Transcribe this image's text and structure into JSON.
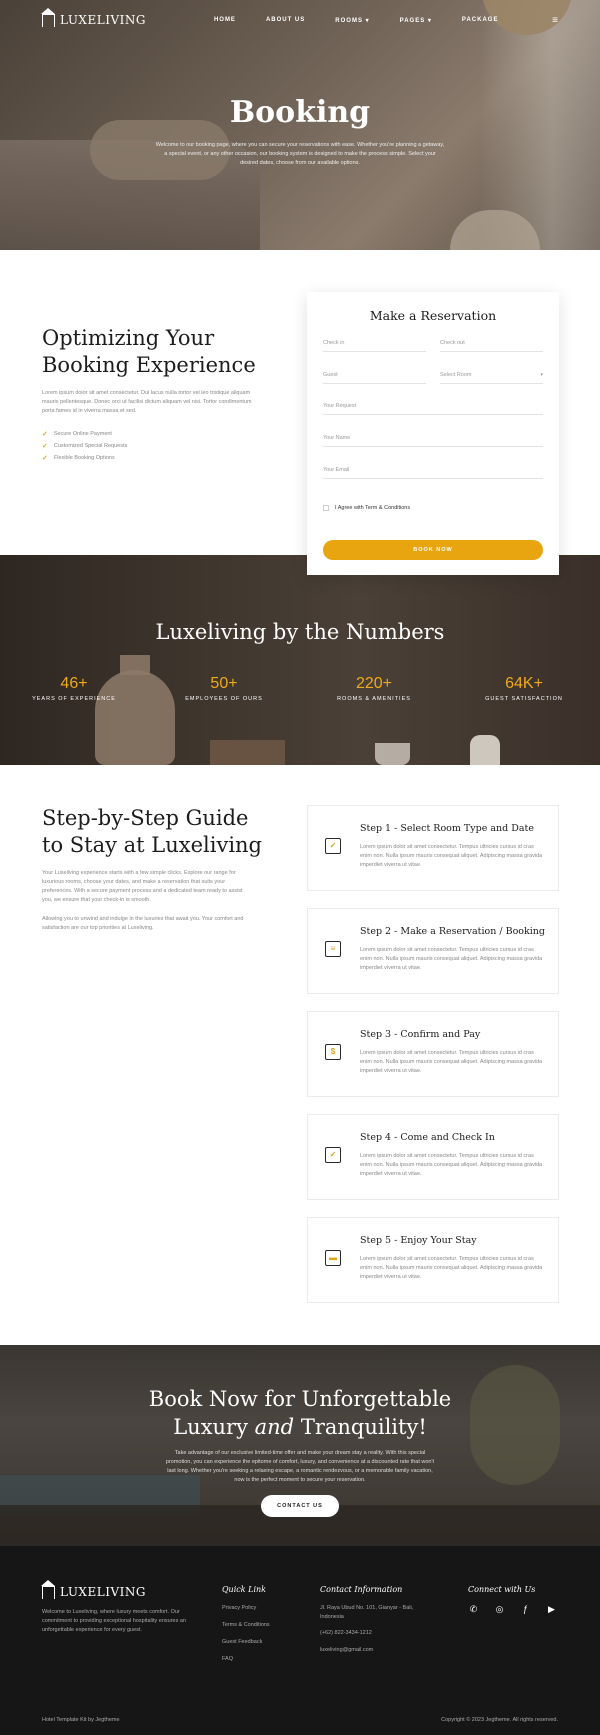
{
  "nav": {
    "logo": "LUXELIVING",
    "items": [
      "HOME",
      "ABOUT US",
      "ROOMS ▾",
      "PAGES ▾",
      "PACKAGE"
    ],
    "menu_icon": "hamburger-icon"
  },
  "hero": {
    "title": "Booking",
    "subtitle": "Welcome to our booking page, where you can secure your reservations with ease. Whether you're planning a getaway, a special event, or any other occasion, our booking system is designed to make the process simple. Select your desired dates, choose from our available options."
  },
  "booking": {
    "heading_line1": "Optimizing Your",
    "heading_line2": "Booking Experience",
    "text": "Lorem ipsum dolor sit amet consectetur. Dui lacus nulla tortor vel leo tristique aliquam mauris pellentesque. Donec orci ut facilisi dictum aliquam vel nisi. Tortor condimentum porta fames id in viverra massa et sed.",
    "checks": [
      "Secure Online Payment",
      "Customized Special Requests",
      "Flexible Booking Options"
    ]
  },
  "reservation": {
    "title": "Make a Reservation",
    "check_in": "Check in",
    "check_out": "Check out",
    "guest": "Guest",
    "select_room": "Select Room",
    "request": "Your Request",
    "name": "Your Name",
    "email": "Your Email",
    "agree": "I Agree with Term & Conditions",
    "button": "BOOK NOW"
  },
  "numbers": {
    "title": "Luxeliving by the Numbers",
    "stats": [
      {
        "value": "46",
        "suffix": "+",
        "label": "YEARS OF EXPERIENCE"
      },
      {
        "value": "50",
        "suffix": "+",
        "label": "EMPLOYEES OF OURS"
      },
      {
        "value": "220",
        "suffix": "+",
        "label": "ROOMS & AMENITIES"
      },
      {
        "value": "64K",
        "suffix": "+",
        "label": "GUEST SATISFACTION"
      }
    ]
  },
  "guide": {
    "heading_line1": "Step-by-Step Guide",
    "heading_line2": "to Stay at Luxeliving",
    "text1": "Your Luxeliving experience starts with a few simple clicks. Explore our range for luxurious rooms, choose your dates, and make a reservation that suits your preferences. With a secure payment process and a dedicated team ready to assist you, we ensure that your check-in is smooth.",
    "text2": "Allowing you to unwind and indulge in the luxuries that await you. Your comfort and satisfaction are our top priorities at Luxeliving.",
    "steps": [
      {
        "title": "Step 1 - Select Room Type and Date",
        "text": "Lorem ipsum dolor sit amet consectetur. Tempus ultricies cursus id cras enim non. Nulla ipsum mauris consequat aliquet. Adipiscing massa gravida imperdiet viverra ut vitae."
      },
      {
        "title": "Step 2 - Make a Reservation / Booking",
        "text": "Lorem ipsum dolor sit amet consectetur. Tempus ultricies cursus id cras enim non. Nulla ipsum mauris consequat aliquet. Adipiscing massa gravida imperdiet viverra ut vitae."
      },
      {
        "title": "Step 3 - Confirm and Pay",
        "text": "Lorem ipsum dolor sit amet consectetur. Tempus ultricies cursus id cras enim non. Nulla ipsum mauris consequat aliquet. Adipiscing massa gravida imperdiet viverra ut vitae."
      },
      {
        "title": "Step 4 - Come and Check In",
        "text": "Lorem ipsum dolor sit amet consectetur. Tempus ultricies cursus id cras enim non. Nulla ipsum mauris consequat aliquet. Adipiscing massa gravida imperdiet viverra ut vitae."
      },
      {
        "title": "Step 5 - Enjoy Your Stay",
        "text": "Lorem ipsum dolor sit amet consectetur. Tempus ultricies cursus id cras enim non. Nulla ipsum mauris consequat aliquet. Adipiscing massa gravida imperdiet viverra ut vitae."
      }
    ]
  },
  "cta": {
    "line1": "Book Now for Unforgettable",
    "line2_pre": "Luxury ",
    "line2_em": "and",
    "line2_post": " Tranquility!",
    "text": "Take advantage of our exclusive limited-time offer and make your dream stay a reality. With this special promotion, you can experience the epitome of comfort, luxury, and convenience at a discounted rate that won't last long. Whether you're seeking a relaxing escape, a romantic rendezvous, or a memorable family vacation, now is the perfect moment to secure your reservation.",
    "button": "CONTACT US"
  },
  "footer": {
    "logo": "LUXELIVING",
    "description": "Welcome to Luxeliving, where luxury meets comfort. Our commitment to providing exceptional hospitality ensures an unforgettable experience for every guest.",
    "quick_title": "Quick Link",
    "quick_links": [
      "Privacy Policy",
      "Terms & Conditions",
      "Guest Feedback",
      "FAQ"
    ],
    "contact_title": "Contact Information",
    "address": "Jl. Raya Ubud No. 101, Gianyar - Bali, Indonesia",
    "phone": "(+62) 822-3434-1212",
    "email": "luxeliving@gmail.com",
    "connect_title": "Connect with Us",
    "socials": [
      "whatsapp-icon",
      "instagram-icon",
      "facebook-icon",
      "youtube-icon"
    ],
    "credit": "Hotel Template Kit by Jegtheme",
    "copyright": "Copyright © 2023 Jegtheme. All rights reserved."
  },
  "colors": {
    "accent": "#e9a50f",
    "dark": "#161616",
    "heading": "#1c1c1c"
  }
}
